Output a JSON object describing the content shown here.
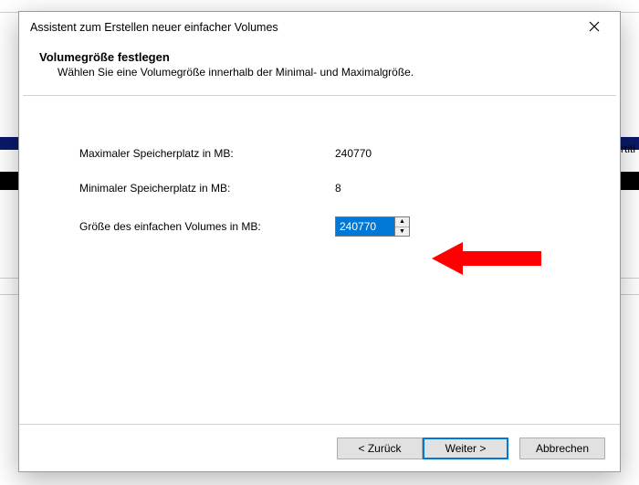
{
  "window": {
    "title": "Assistent zum Erstellen neuer einfacher Volumes"
  },
  "header": {
    "title": "Volumegröße festlegen",
    "subtitle": "Wählen Sie eine Volumegröße innerhalb der Minimal- und Maximalgröße."
  },
  "fields": {
    "max_label": "Maximaler Speicherplatz in MB:",
    "max_value": "240770",
    "min_label": "Minimaler Speicherplatz in MB:",
    "min_value": "8",
    "size_label": "Größe des einfachen Volumes in MB:",
    "size_value": "240770"
  },
  "buttons": {
    "back": "< Zurück",
    "next": "Weiter >",
    "cancel": "Abbrechen"
  },
  "bg": {
    "snip": "rtiti"
  }
}
